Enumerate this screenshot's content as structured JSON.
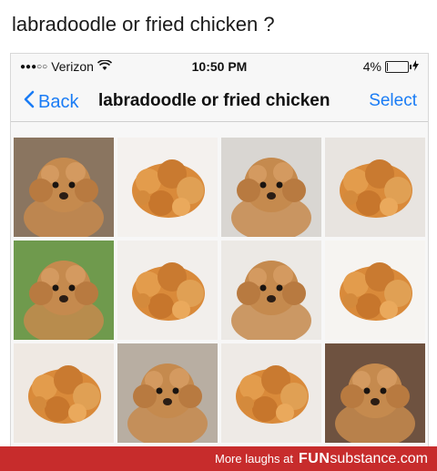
{
  "caption": "labradoodle or fried chicken ?",
  "status": {
    "carrier": "Verizon",
    "signal_dots": "●●●○○",
    "time": "10:50 PM",
    "battery_pct": "4%",
    "battery_level": 0.04
  },
  "nav": {
    "back_label": "Back",
    "title": "labradoodle or fried chicken",
    "select_label": "Select"
  },
  "tiles": [
    {
      "type": "dog",
      "bg": "#8a7560"
    },
    {
      "type": "chicken",
      "bg": "#f4f1ee"
    },
    {
      "type": "dog",
      "bg": "#d9d6d2"
    },
    {
      "type": "chicken",
      "bg": "#e8e4e0"
    },
    {
      "type": "dog",
      "bg": "#6f9a4d"
    },
    {
      "type": "chicken",
      "bg": "#f2efec"
    },
    {
      "type": "dog",
      "bg": "#ece9e5"
    },
    {
      "type": "chicken",
      "bg": "#f6f4f1"
    },
    {
      "type": "chicken",
      "bg": "#efe9e3"
    },
    {
      "type": "dog",
      "bg": "#b8aea2"
    },
    {
      "type": "chicken",
      "bg": "#eeeae6"
    },
    {
      "type": "dog",
      "bg": "#6e5240"
    }
  ],
  "footer": {
    "prefix": "More laughs at",
    "brand_fun": "FUN",
    "brand_rest": "substance.com"
  },
  "colors": {
    "ios_blue": "#1a7cf5",
    "footer_red": "#c72c2c",
    "dog_fur": "#c58a4e",
    "chicken_crust": "#d98a3a"
  }
}
